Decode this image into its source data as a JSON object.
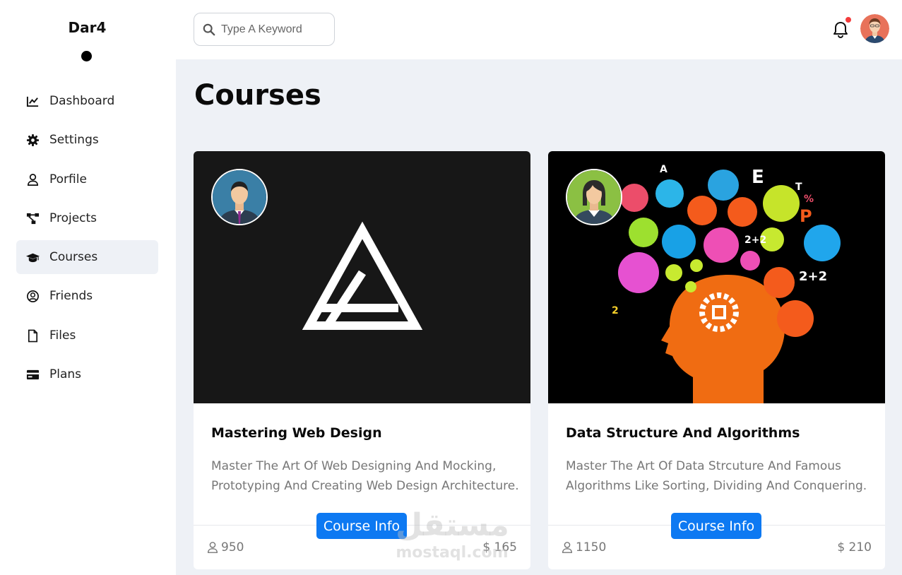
{
  "brand": {
    "name": "Dar4"
  },
  "sidebar": {
    "items": [
      {
        "label": "Dashboard",
        "icon": "chart-line-icon"
      },
      {
        "label": "Settings",
        "icon": "gear-icon"
      },
      {
        "label": "Porfile",
        "icon": "user-icon"
      },
      {
        "label": "Projects",
        "icon": "diagram-project-icon"
      },
      {
        "label": "Courses",
        "icon": "graduation-cap-icon",
        "active": true
      },
      {
        "label": "Friends",
        "icon": "user-circle-icon"
      },
      {
        "label": "Files",
        "icon": "file-icon"
      },
      {
        "label": "Plans",
        "icon": "credit-card-icon"
      }
    ]
  },
  "header": {
    "search_placeholder": "Type A Keyword",
    "notification_icon": "bell-icon",
    "has_notification": true
  },
  "page": {
    "title": "Courses"
  },
  "courses": [
    {
      "title": "Mastering Web Design",
      "description": "Master The Art Of Web Designing And Mocking, Prototyping And Creating Web Design Architecture.",
      "button": "Course Info",
      "students": "950",
      "price": "$ 165"
    },
    {
      "title": "Data Structure And Algorithms",
      "description": "Master The Art Of Data Strcuture And Famous Algorithms Like Sorting, Dividing And Conquering.",
      "button": "Course Info",
      "students": "1150",
      "price": "$ 210"
    }
  ],
  "watermark": {
    "arabic": "مستقل",
    "latin": "mostaql.com"
  },
  "colors": {
    "accent": "#0d79f2",
    "badge": "#f33b3b",
    "background": "#eef1f6"
  }
}
